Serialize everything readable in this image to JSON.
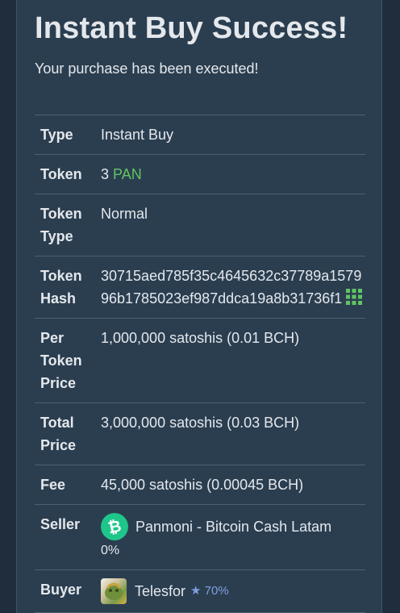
{
  "header": {
    "title": "Instant Buy Success!",
    "subtitle": "Your purchase has been executed!"
  },
  "details": {
    "type": {
      "label": "Type",
      "value": "Instant Buy"
    },
    "token": {
      "label": "Token",
      "amount": "3",
      "symbol": "PAN"
    },
    "token_type": {
      "label": "Token Type",
      "value": "Normal"
    },
    "token_hash": {
      "label": "Token Hash",
      "value": "30715aed785f35c4645632c37789a157996b1785023ef987ddca19a8b31736f1"
    },
    "per_token_price": {
      "label": "Per Token Price",
      "value": "1,000,000 satoshis (0.01 BCH)"
    },
    "total_price": {
      "label": "Total Price",
      "value": "3,000,000 satoshis (0.03 BCH)"
    },
    "fee": {
      "label": "Fee",
      "value": "45,000 satoshis (0.00045 BCH)"
    },
    "seller": {
      "label": "Seller",
      "name": "Panmoni - Bitcoin Cash Latam",
      "percent": "0%"
    },
    "buyer": {
      "label": "Buyer",
      "name": "Telesfor",
      "rating": "★ 70%"
    }
  },
  "icons": {
    "hash": "qr-code-icon",
    "seller": "bitcoin-cash-icon",
    "buyer": "avatar-image"
  },
  "colors": {
    "background": "#1f2d3c",
    "card": "#2b3e50",
    "accent_green": "#62c462",
    "bch_green": "#1ec68a",
    "rating_blue": "#7d9fe0"
  }
}
